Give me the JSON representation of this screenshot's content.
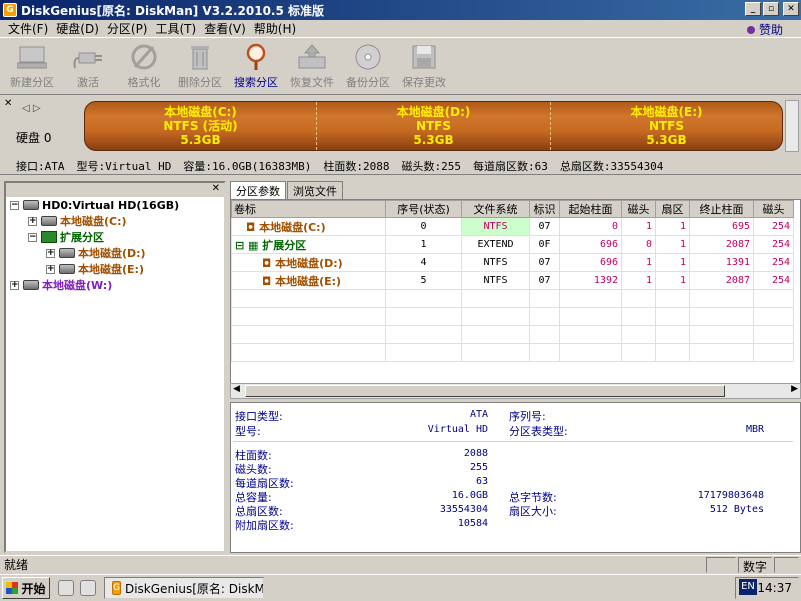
{
  "window": {
    "title": "DiskGenius[原名: DiskMan] V3.2.2010.5 标准版"
  },
  "menu": {
    "items": [
      "文件(F)",
      "硬盘(D)",
      "分区(P)",
      "工具(T)",
      "查看(V)",
      "帮助(H)"
    ],
    "sponsor": "赞助"
  },
  "toolbar": {
    "new_partition": "新建分区",
    "activate": "激活",
    "format": "格式化",
    "delete_partition": "删除分区",
    "search_partition": "搜索分区",
    "restore_file": "恢复文件",
    "backup_partition": "备份分区",
    "save_changes": "保存更改"
  },
  "disk": {
    "label": "硬盘 0",
    "partitions": [
      {
        "name": "本地磁盘(C:)",
        "fs": "NTFS (活动)",
        "size": "5.3GB"
      },
      {
        "name": "本地磁盘(D:)",
        "fs": "NTFS",
        "size": "5.3GB"
      },
      {
        "name": "本地磁盘(E:)",
        "fs": "NTFS",
        "size": "5.3GB"
      }
    ],
    "info": {
      "interface": "接口:ATA",
      "model": "型号:Virtual HD",
      "capacity": "容量:16.0GB(16383MB)",
      "cylinders": "柱面数:2088",
      "heads": "磁头数:255",
      "sectors_per_track": "每道扇区数:63",
      "total_sectors": "总扇区数:33554304"
    }
  },
  "tree": {
    "root": "HD0:Virtual HD(16GB)",
    "c": "本地磁盘(C:)",
    "ext": "扩展分区",
    "d": "本地磁盘(D:)",
    "e": "本地磁盘(E:)",
    "w": "本地磁盘(W:)"
  },
  "tabs": {
    "params": "分区参数",
    "browse": "浏览文件"
  },
  "table": {
    "headers": [
      "卷标",
      "序号(状态)",
      "文件系统",
      "标识",
      "起始柱面",
      "磁头",
      "扇区",
      "终止柱面",
      "磁头"
    ],
    "rows": [
      {
        "name": "本地磁盘(C:)",
        "seq": "0",
        "fs": "NTFS",
        "id": "07",
        "start_cyl": "0",
        "head": "1",
        "sector": "1",
        "end_cyl": "695",
        "end_head": "254"
      },
      {
        "name": "扩展分区",
        "seq": "1",
        "fs": "EXTEND",
        "id": "0F",
        "start_cyl": "696",
        "head": "0",
        "sector": "1",
        "end_cyl": "2087",
        "end_head": "254"
      },
      {
        "name": "本地磁盘(D:)",
        "seq": "4",
        "fs": "NTFS",
        "id": "07",
        "start_cyl": "696",
        "head": "1",
        "sector": "1",
        "end_cyl": "1391",
        "end_head": "254"
      },
      {
        "name": "本地磁盘(E:)",
        "seq": "5",
        "fs": "NTFS",
        "id": "07",
        "start_cyl": "1392",
        "head": "1",
        "sector": "1",
        "end_cyl": "2087",
        "end_head": "254"
      }
    ]
  },
  "details": {
    "interface_label": "接口类型:",
    "interface_value": "ATA",
    "serial_label": "序列号:",
    "model_label": "型号:",
    "model_value": "Virtual HD",
    "ptable_label": "分区表类型:",
    "ptable_value": "MBR",
    "cyl_label": "柱面数:",
    "cyl_value": "2088",
    "heads_label": "磁头数:",
    "heads_value": "255",
    "spt_label": "每道扇区数:",
    "spt_value": "63",
    "cap_label": "总容量:",
    "cap_value": "16.0GB",
    "bytes_label": "总字节数:",
    "bytes_value": "17179803648",
    "sectors_label": "总扇区数:",
    "sectors_value": "33554304",
    "ssize_label": "扇区大小:",
    "ssize_value": "512 Bytes",
    "extra_label": "附加扇区数:",
    "extra_value": "10584"
  },
  "status": {
    "text": "就绪",
    "numlock": "数字"
  },
  "taskbar": {
    "start": "开始",
    "task": "DiskGenius[原名: DiskMa...",
    "lang": "EN",
    "clock": "14:37"
  }
}
